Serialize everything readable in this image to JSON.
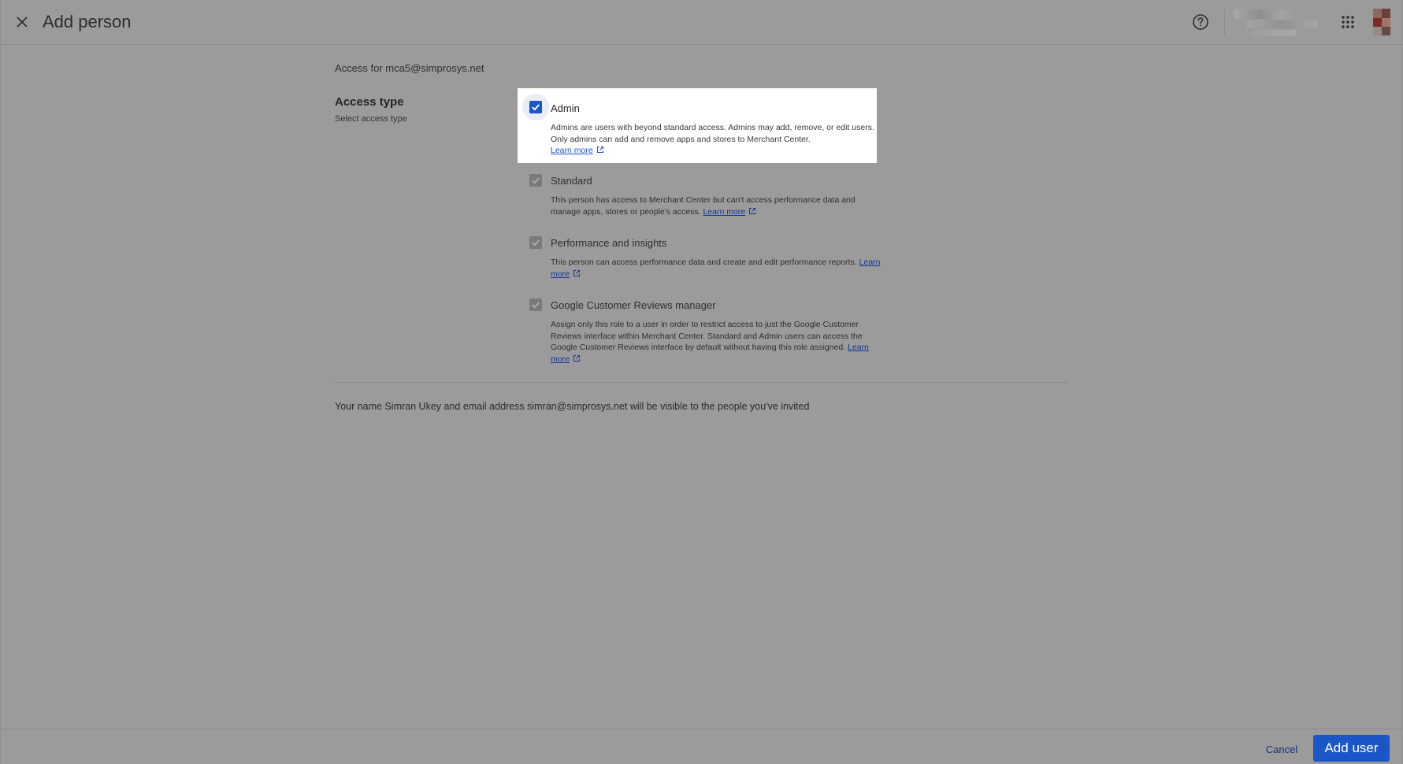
{
  "header": {
    "title": "Add person",
    "close_icon": "close-icon",
    "help_icon": "help-circle-icon",
    "apps_icon": "apps-grid-icon"
  },
  "main": {
    "access_for": "Access for mca5@simprosys.net",
    "access_type": {
      "title": "Access type",
      "subtitle": "Select access type"
    },
    "options": [
      {
        "label": "Admin",
        "description": "Admins are users with beyond standard access. Admins may add, remove, or edit users. Only admins can add and remove apps and stores to Merchant Center.",
        "link": "Learn more",
        "checked": true
      },
      {
        "label": "Standard",
        "description": "This person has access to Merchant Center but can't access performance data and manage apps, stores or people's access.",
        "link": "Learn more",
        "checked": true
      },
      {
        "label": "Performance and insights",
        "description": "This person can access performance data and create and edit performance reports.",
        "link": "Learn more",
        "checked": true
      },
      {
        "label": "Google Customer Reviews manager",
        "description": "Assign only this role to a user in order to restrict access to just the Google Customer Reviews interface within Merchant Center. Standard and Admin users can access the Google Customer Reviews interface by default without having this role assigned.",
        "link": "Learn more",
        "checked": true
      }
    ],
    "visibility_note": "Your name Simran Ukey and email address simran@simprosys.net will be visible to the people you've invited"
  },
  "footer": {
    "cancel_label": "Cancel",
    "add_user_label": "Add user"
  },
  "colors": {
    "overlay_background": "#9b9b9b",
    "primary_blue": "#1a56c6",
    "card_background": "#ffffff"
  }
}
